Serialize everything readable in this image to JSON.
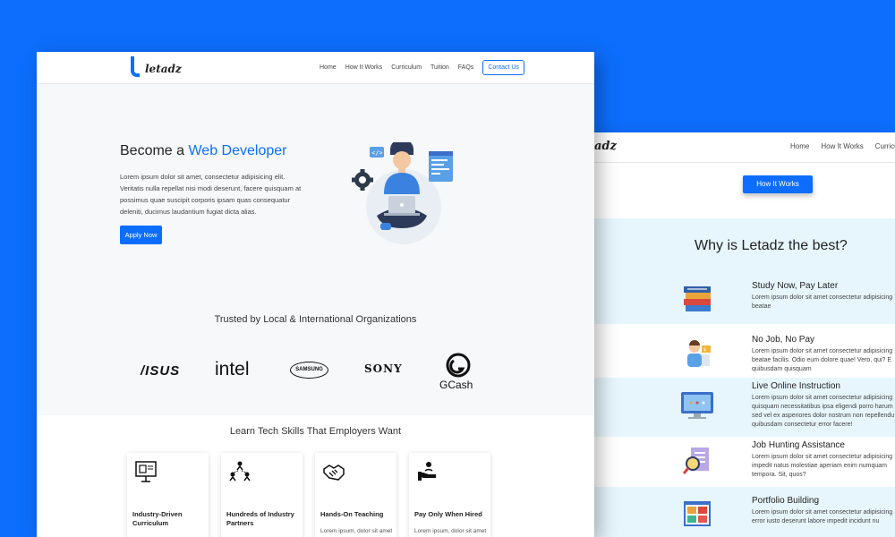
{
  "back_window": {
    "logo": "adz",
    "nav": [
      "Home",
      "How It Works",
      "Curricul"
    ],
    "cta": "How It Works",
    "why_title": "Why is Letadz the best?",
    "items": [
      {
        "title": "Study Now, Pay Later",
        "text": "Lorem ipsum dolor sit amet consectetur adipisicing beatae",
        "icon": "books-icon"
      },
      {
        "title": "No Job, No Pay",
        "text": "Lorem ipsum dolor sit amet consectetur adipisicing beatae facilis. Odio eum dolore quae! Vero, qui? E quibusdam quisquam",
        "icon": "job-seeker-icon"
      },
      {
        "title": "Live Online Instruction",
        "text": "Lorem ipsum dolor sit amet consectetur adipisicing quisquam necessitatibus ipsa eligendi porro harum sed vel ex asperiores dolor nostrum non repellendu quibusdam consectetur error facere!",
        "icon": "monitor-icon"
      },
      {
        "title": "Job Hunting Assistance",
        "text": "Lorem ipsum dolor sit amet consectetur adipisicing impedit natus molestiae aperiam enim numquam tempora. Sit, quos?",
        "icon": "search-document-icon"
      },
      {
        "title": "Portfolio Building",
        "text": "Lorem ipsum dolor sit amet consectetur adipisicing error iusto deserunt labore impedit incidunt nu",
        "icon": "portfolio-icon"
      }
    ]
  },
  "front_window": {
    "logo": "letadz",
    "nav": {
      "home": "Home",
      "how": "How It Works",
      "curriculum": "Curriculum",
      "tuition": "Tuition",
      "faqs": "FAQs",
      "contact": "Contact Us"
    },
    "hero": {
      "title_plain": "Become a ",
      "title_highlight": "Web Developer",
      "description": "Lorem ipsum dolor sit amet, consectetur adipisicing elit. Veritatis nulla repellat nisi modi deserunt, facere quisquam at possimus quae suscipit corporis ipsam quas consequatur deleniti, ducimus laudantium fugiat dicta alias.",
      "apply": "Apply Now"
    },
    "trusted_title": "Trusted by Local & International Organizations",
    "brands": [
      "/ISUS",
      "intel",
      "SAMSUNG",
      "SONY",
      "GCash"
    ],
    "skills_title": "Learn Tech Skills That Employers Want",
    "cards": [
      {
        "title": "Industry-Driven Curriculum",
        "text": "",
        "icon": "curriculum-icon"
      },
      {
        "title": "Hundreds of Industry Partners",
        "text": "",
        "icon": "partners-icon"
      },
      {
        "title": "Hands-On Teaching",
        "text": "Lorem ipsum, dolor sit amet",
        "icon": "handshake-icon"
      },
      {
        "title": "Pay Only When Hired",
        "text": "Lorem ipsum, dolor sit amet",
        "icon": "payment-icon"
      }
    ]
  },
  "colors": {
    "accent": "#0d6efd",
    "background": "#0d6efd",
    "band": "#e7f6fd"
  }
}
